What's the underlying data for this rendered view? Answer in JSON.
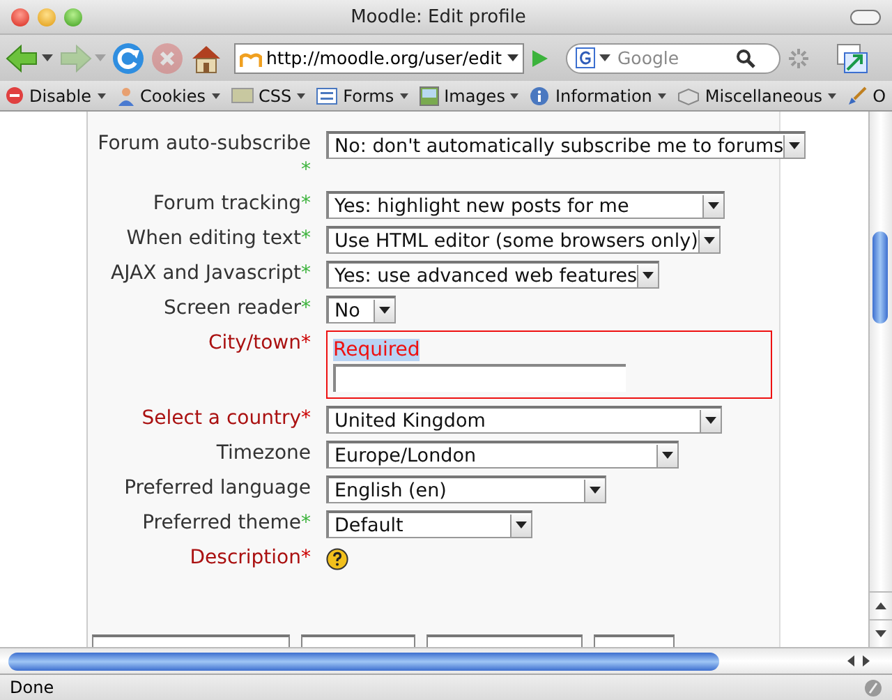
{
  "window": {
    "title": "Moodle: Edit profile"
  },
  "nav_toolbar": {
    "forward_disabled": true,
    "stop_disabled": true,
    "url": "http://moodle.org/user/edit",
    "search_placeholder": "Google"
  },
  "web_developer_toolbar": [
    {
      "label": "Disable",
      "kind": "disable"
    },
    {
      "label": "Cookies",
      "kind": "cookies"
    },
    {
      "label": "CSS",
      "kind": "css"
    },
    {
      "label": "Forms",
      "kind": "forms"
    },
    {
      "label": "Images",
      "kind": "images"
    },
    {
      "label": "Information",
      "kind": "information"
    },
    {
      "label": "Miscellaneous",
      "kind": "misc"
    },
    {
      "label": "O",
      "kind": "outline"
    }
  ],
  "form": {
    "rows": [
      {
        "kind": "select",
        "label": "Forum auto-subscribe",
        "mark": "*",
        "required": false,
        "value": "No: don't automatically subscribe me to forums",
        "invalid": false
      },
      {
        "kind": "select",
        "label": "Forum tracking",
        "mark": "*",
        "required": false,
        "value": "Yes: highlight new posts for me",
        "invalid": false
      },
      {
        "kind": "select",
        "label": "When editing text",
        "mark": "*",
        "required": false,
        "value": "Use HTML editor (some browsers only)",
        "invalid": false
      },
      {
        "kind": "select",
        "label": "AJAX and Javascript",
        "mark": "*",
        "required": false,
        "value": "Yes: use advanced web features",
        "invalid": false
      },
      {
        "kind": "select",
        "label": "Screen reader",
        "mark": "*",
        "required": false,
        "value": "No",
        "invalid": false
      },
      {
        "kind": "text",
        "label": "City/town",
        "mark": "*",
        "required": true,
        "invalid": true,
        "error": "Required"
      },
      {
        "kind": "select",
        "label": "Select a country",
        "mark": "*",
        "required": true,
        "value": "United Kingdom",
        "invalid": false
      },
      {
        "kind": "select",
        "label": "Timezone",
        "value": "Europe/London",
        "invalid": false
      },
      {
        "kind": "select",
        "label": "Preferred language",
        "value": "English (en)",
        "invalid": false
      },
      {
        "kind": "select",
        "label": "Preferred theme",
        "mark": "*",
        "required": false,
        "value": "Default",
        "invalid": false
      },
      {
        "kind": "editor",
        "label": "Description",
        "mark": "*",
        "required": true,
        "invalid": false,
        "help": true
      }
    ]
  },
  "status_bar": {
    "text": "Done"
  }
}
